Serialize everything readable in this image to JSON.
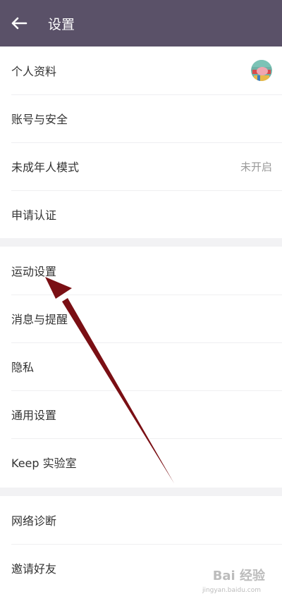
{
  "header": {
    "title": "设置",
    "back_icon": "arrow-left-icon"
  },
  "groups": [
    {
      "items": [
        {
          "label": "个人资料"
        },
        {
          "label": "账号与安全"
        },
        {
          "label": "未成年人模式",
          "value": "未开启"
        },
        {
          "label": "申请认证"
        }
      ]
    },
    {
      "items": [
        {
          "label": "运动设置"
        },
        {
          "label": "消息与提醒"
        },
        {
          "label": "隐私"
        },
        {
          "label": "通用设置"
        },
        {
          "label": "Keep 实验室"
        }
      ]
    },
    {
      "items": [
        {
          "label": "网络诊断"
        },
        {
          "label": "邀请好友"
        }
      ]
    }
  ],
  "annotation": {
    "arrow_color": "#7a0f14"
  },
  "watermark": {
    "text": "Bai 经验",
    "sub": "jingyan.baidu.com"
  }
}
